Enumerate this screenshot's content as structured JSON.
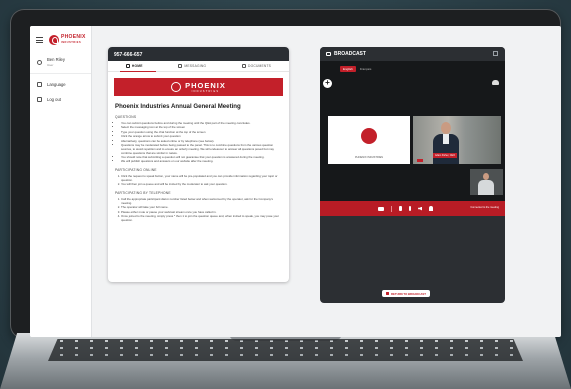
{
  "nav": {
    "logo_text": "PHOENIX",
    "logo_sub": "INDUSTRIES",
    "user_name": "Ben Riley",
    "user_sub": "User",
    "items": [
      {
        "label": "Language"
      },
      {
        "label": "Log out"
      }
    ]
  },
  "panel": {
    "meeting_id": "957-666-657",
    "tabs": [
      {
        "label": "HOME",
        "icon": "home-icon",
        "active": true
      },
      {
        "label": "MESSAGING",
        "icon": "chat-icon",
        "active": false
      },
      {
        "label": "DOCUMENTS",
        "icon": "document-icon",
        "active": false
      }
    ],
    "banner_word": "PHOENIX",
    "banner_sub": "INDUSTRIES",
    "title": "Phoenix Industries Annual General Meeting",
    "sections": [
      {
        "heading": "QUESTIONS",
        "list_type": "ul",
        "items": [
          "You can submit questions before and during the meeting until the Q&A part of the meeting concludes.",
          "Select the messaging icon at the top of the screen",
          "Type your question using the chat function at the top of the screen",
          "Click the orange arrow to submit your question",
          "Alternatively, questions can be asked online or by telephone (see below).",
          "Questions may be moderated before being passed to the panel. This is to combine questions from the various question sources, to avoid repetition and to ensure an orderly meeting. We will endeavour to answer all questions posed but may combine questions that are similar in nature.",
          "You should note that submitting a question will not guarantee that your question is answered during the meeting.",
          "We will publish questions and answers on our website after the meeting."
        ]
      },
      {
        "heading": "PARTICIPATING ONLINE",
        "list_type": "ol",
        "items": [
          "Click the request to speak button, your name will be pre-populated and you can provide information regarding your topic or question.",
          "You will then join a queue and will be invited by the moderator to ask your question."
        ]
      },
      {
        "heading": "PARTICIPATING BY TELEPHONE",
        "list_type": "ol",
        "items": [
          "Call the appropriate participant dial-in number listed below and when welcomed by the operator, ask for the Company's meeting.",
          "The operator will take your full name.",
          "Please either mute or pause your webcast stream once you have called in.",
          "Once joined to the meeting, simply press * then 1 to join the question queue and, when invited to speak, you may pose your question."
        ]
      }
    ]
  },
  "broadcast": {
    "title": "BROADCAST",
    "languages": {
      "active": "English",
      "other": "Français"
    },
    "slide_caption": "PHOENIX INDUSTRIES",
    "speaker_name": "Adam Fisher, CEO",
    "control_label": "Connected to the meeting",
    "return_label": "RETURN TO BROADCAST"
  }
}
